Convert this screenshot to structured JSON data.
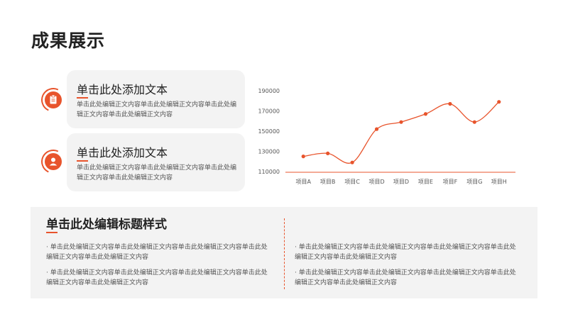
{
  "page": {
    "title": "成果展示"
  },
  "cards": [
    {
      "title": "单击此处添加文本",
      "body": "单击此处编辑正文内容单击此处编辑正文内容单击此处编辑正文内容单击此处编辑正文内容",
      "icon": "clipboard-icon"
    },
    {
      "title": "单击此处添加文本",
      "body": "单击此处编辑正文内容单击此处编辑正文内容单击此处编辑正文内容单击此处编辑正文内容",
      "icon": "user-icon"
    }
  ],
  "bottom": {
    "title": "单击此处编辑标题样式",
    "left_items": [
      "单击此处编辑正文内容单击此处编辑正文内容单击此处编辑正文内容单击此处编辑正文内容单击此处编辑正文内容",
      "单击此处编辑正文内容单击此处编辑正文内容单击此处编辑正文内容单击此处编辑正文内容单击此处编辑正文内容"
    ],
    "right_items": [
      "单击此处编辑正文内容单击此处编辑正文内容单击此处编辑正文内容单击此处编辑正文内容单击此处编辑正文内容",
      "单击此处编辑正文内容单击此处编辑正文内容单击此处编辑正文内容单击此处编辑正文内容单击此处编辑正文内容"
    ]
  },
  "colors": {
    "accent": "#e8542c"
  },
  "chart_data": {
    "type": "line",
    "categories": [
      "项目A",
      "项目B",
      "项目C",
      "项目D",
      "项目D",
      "项目E",
      "项目F",
      "项目G",
      "项目H"
    ],
    "values": [
      125000,
      128000,
      119000,
      152000,
      159000,
      167000,
      177000,
      159000,
      179000
    ],
    "ylim": [
      110000,
      190000
    ],
    "yticks": [
      "190000",
      "170000",
      "150000",
      "130000",
      "110000"
    ],
    "title": "",
    "xlabel": "",
    "ylabel": "",
    "grid": false,
    "smooth": true
  }
}
